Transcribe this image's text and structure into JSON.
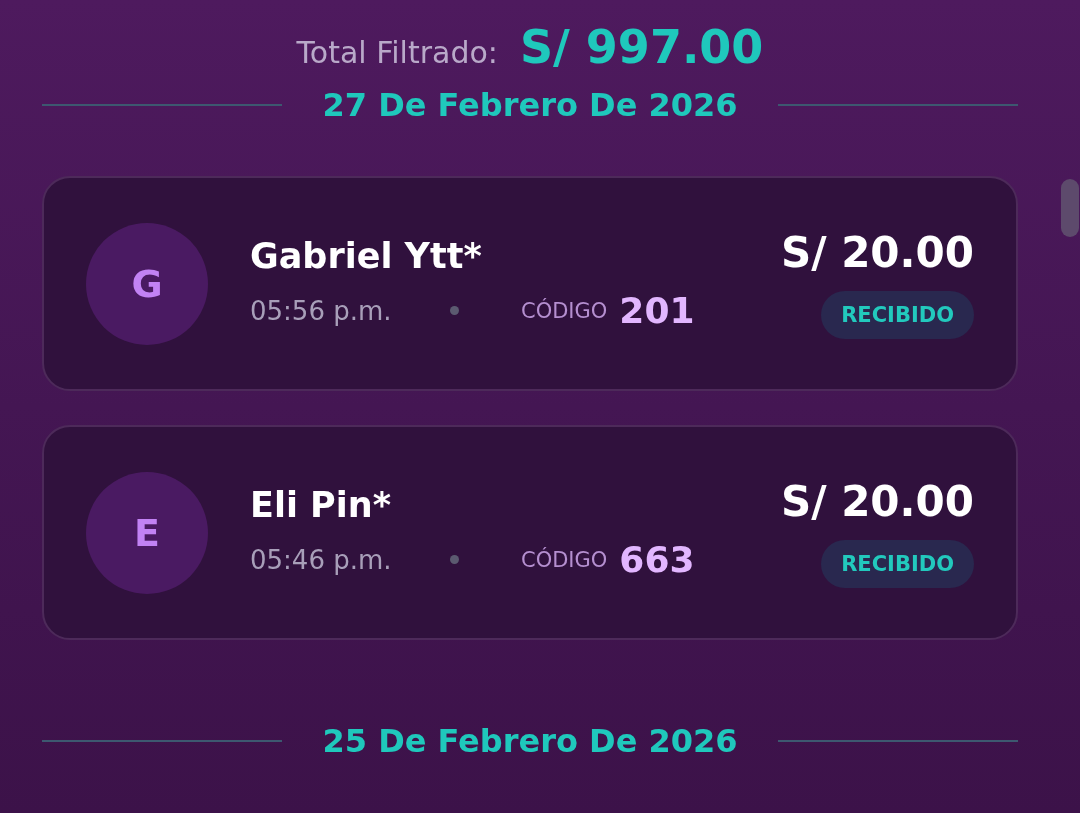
{
  "total": {
    "label": "Total Filtrado:",
    "amount": "S/ 997.00"
  },
  "groups": [
    {
      "date": "27 De Febrero De 2026",
      "transactions": [
        {
          "initial": "G",
          "name": "Gabriel Ytt*",
          "time": "05:56 p.m.",
          "code_label": "CÓDIGO",
          "code": "201",
          "amount": "S/ 20.00",
          "status": "RECIBIDO"
        },
        {
          "initial": "E",
          "name": "Eli Pin*",
          "time": "05:46 p.m.",
          "code_label": "CÓDIGO",
          "code": "663",
          "amount": "S/ 20.00",
          "status": "RECIBIDO"
        }
      ]
    },
    {
      "date": "25 De Febrero De 2026"
    }
  ]
}
